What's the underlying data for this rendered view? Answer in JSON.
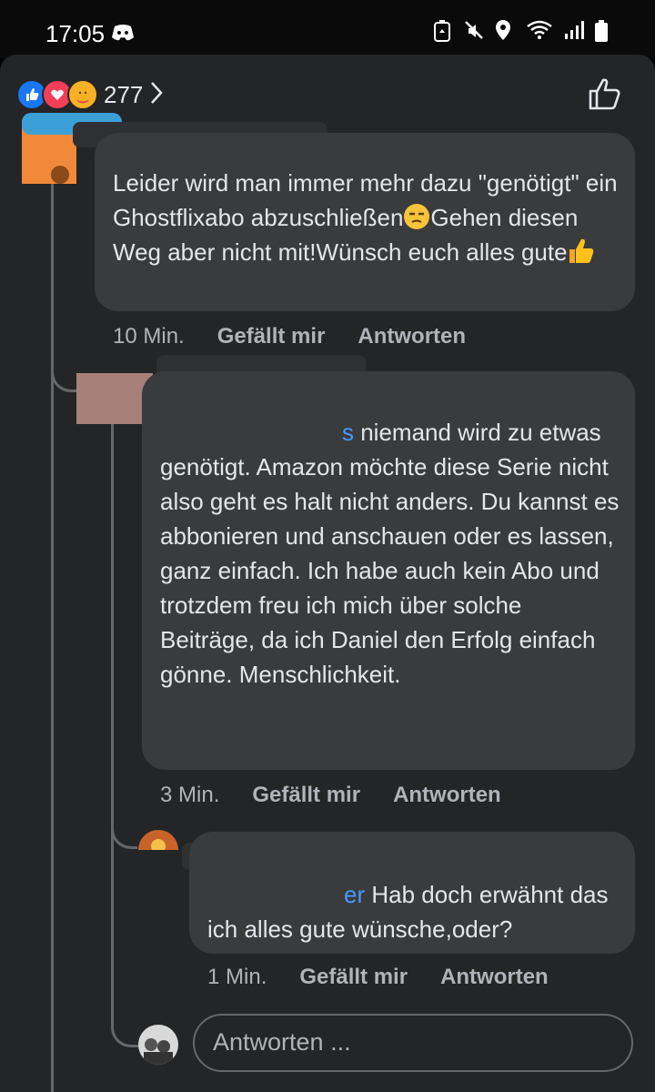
{
  "status_bar": {
    "time": "17:05",
    "icons": [
      "discord-icon",
      "battery-saver-icon",
      "mute-icon",
      "location-icon",
      "wifi-icon",
      "signal-icon",
      "battery-icon"
    ]
  },
  "reactions": {
    "count": "277",
    "types": [
      "like",
      "love",
      "care"
    ]
  },
  "comments": [
    {
      "text": "Leider wird man immer mehr dazu \"genötigt\" ein Ghostflixabo abzuschließen",
      "text_tail": "Gehen diesen Weg aber nicht mit!Wünsch euch alles gute",
      "emojis": [
        "unamused-face",
        "thumbs-up"
      ],
      "time": "10 Min.",
      "like_label": "Gefällt mir",
      "reply_label": "Antworten"
    },
    {
      "mention_tail": "s",
      "text": " niemand wird zu etwas genötigt. Amazon möchte diese Serie nicht also geht es halt nicht anders. Du kannst es abbonieren und anschauen oder es lassen, ganz einfach. Ich habe auch kein Abo und trotzdem freu ich mich über solche Beiträge, da ich Daniel den Erfolg einfach gönne. Menschlichkeit.",
      "time": "3 Min.",
      "like_label": "Gefällt mir",
      "reply_label": "Antworten"
    },
    {
      "mention_tail": "er",
      "text": " Hab doch erwähnt das ich alles gute wünsche,oder?",
      "time": "1 Min.",
      "like_label": "Gefällt mir",
      "reply_label": "Antworten"
    }
  ],
  "reply_input": {
    "placeholder": "Antworten ..."
  },
  "colors": {
    "sheet_bg": "#242526",
    "bubble_bg": "#3a3b3c",
    "text": "#e4e6eb",
    "meta": "#b0b3b8",
    "mention": "#4599ff"
  }
}
